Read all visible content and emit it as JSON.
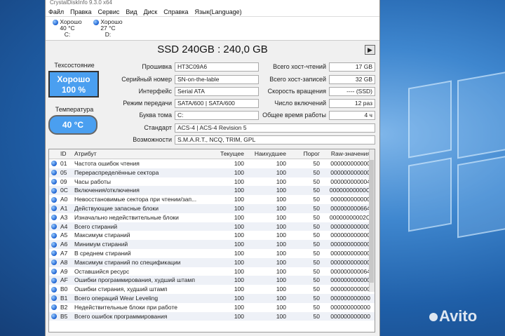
{
  "window": {
    "title": "CrystalDiskInfo 9.3.0 x64"
  },
  "menu": [
    "Файл",
    "Правка",
    "Сервис",
    "Вид",
    "Диск",
    "Справка",
    "Язык(Language)"
  ],
  "drives": [
    {
      "status": "Хорошо",
      "temp": "40 °C",
      "letter": "C:"
    },
    {
      "status": "Хорошо",
      "temp": "27 °C",
      "letter": "D:"
    }
  ],
  "disk": {
    "title": "SSD 240GB : 240,0 GB",
    "play_icon": "play-icon"
  },
  "health": {
    "label": "Техсостояние",
    "status": "Хорошо",
    "percent": "100 %"
  },
  "temperature": {
    "label": "Температура",
    "value": "40 °C"
  },
  "info_left": [
    {
      "label": "Прошивка",
      "value": "HT3C09A6"
    },
    {
      "label": "Серийный номер",
      "value": "SN-on-the-lable"
    },
    {
      "label": "Интерфейс",
      "value": "Serial ATA"
    },
    {
      "label": "Режим передачи",
      "value": "SATA/600 | SATA/600"
    },
    {
      "label": "Буква тома",
      "value": "C:"
    }
  ],
  "info_right": [
    {
      "label": "Всего хост-чтений",
      "value": "17 GB"
    },
    {
      "label": "Всего хост-записей",
      "value": "32 GB"
    },
    {
      "label": "Скорость вращения",
      "value": "---- (SSD)"
    },
    {
      "label": "Число включений",
      "value": "12 раз"
    },
    {
      "label": "Общее время работы",
      "value": "4 ч"
    }
  ],
  "info_wide": [
    {
      "label": "Стандарт",
      "value": "ACS-4 | ACS-4 Revision 5"
    },
    {
      "label": "Возможности",
      "value": "S.M.A.R.T., NCQ, TRIM, GPL"
    }
  ],
  "table": {
    "headers": {
      "id": "ID",
      "attr": "Атрибут",
      "cur": "Текущее",
      "worst": "Наихудшее",
      "thr": "Порог",
      "raw": "Raw-значения"
    },
    "rows": [
      {
        "id": "01",
        "attr": "Частота ошибок чтения",
        "cur": "100",
        "worst": "100",
        "thr": "50",
        "raw": "000000000000"
      },
      {
        "id": "05",
        "attr": "Перераспределённые сектора",
        "cur": "100",
        "worst": "100",
        "thr": "50",
        "raw": "000000000000"
      },
      {
        "id": "09",
        "attr": "Часы работы",
        "cur": "100",
        "worst": "100",
        "thr": "50",
        "raw": "000000000004"
      },
      {
        "id": "0C",
        "attr": "Включения/отключения",
        "cur": "100",
        "worst": "100",
        "thr": "50",
        "raw": "00000000000C"
      },
      {
        "id": "A0",
        "attr": "Невосстановимые сектора при чтении/зап...",
        "cur": "100",
        "worst": "100",
        "thr": "50",
        "raw": "000000000000"
      },
      {
        "id": "A1",
        "attr": "Действующие запасные блоки",
        "cur": "100",
        "worst": "100",
        "thr": "50",
        "raw": "000000000664"
      },
      {
        "id": "A3",
        "attr": "Изначально недействительные блоки",
        "cur": "100",
        "worst": "100",
        "thr": "50",
        "raw": "00000000002C"
      },
      {
        "id": "A4",
        "attr": "Всего стираний",
        "cur": "100",
        "worst": "100",
        "thr": "50",
        "raw": "000000000000"
      },
      {
        "id": "A5",
        "attr": "Максимум стираний",
        "cur": "100",
        "worst": "100",
        "thr": "50",
        "raw": "000000000000"
      },
      {
        "id": "A6",
        "attr": "Минимум стираний",
        "cur": "100",
        "worst": "100",
        "thr": "50",
        "raw": "000000000000"
      },
      {
        "id": "A7",
        "attr": "В среднем стираний",
        "cur": "100",
        "worst": "100",
        "thr": "50",
        "raw": "000000000000"
      },
      {
        "id": "A8",
        "attr": "Максимум стираний по спецификации",
        "cur": "100",
        "worst": "100",
        "thr": "50",
        "raw": "000000000000"
      },
      {
        "id": "A9",
        "attr": "Оставшийся ресурс",
        "cur": "100",
        "worst": "100",
        "thr": "50",
        "raw": "000000000064"
      },
      {
        "id": "AF",
        "attr": "Ошибки программирования, худший штамп",
        "cur": "100",
        "worst": "100",
        "thr": "50",
        "raw": "000000000000"
      },
      {
        "id": "B0",
        "attr": "Ошибки стирания, худший штамп",
        "cur": "100",
        "worst": "100",
        "thr": "50",
        "raw": "000000000000"
      },
      {
        "id": "B1",
        "attr": "Всего операций Wear Leveling",
        "cur": "100",
        "worst": "100",
        "thr": "50",
        "raw": "000000000000"
      },
      {
        "id": "B2",
        "attr": "Недействительные блоки при работе",
        "cur": "100",
        "worst": "100",
        "thr": "50",
        "raw": "000000000000"
      },
      {
        "id": "B5",
        "attr": "Всего ошибок программирования",
        "cur": "100",
        "worst": "100",
        "thr": "50",
        "raw": "000000000000"
      }
    ]
  },
  "watermark": "Avito",
  "colors": {
    "status_good": "#4a9ff0",
    "dot": "#1a5fd0"
  }
}
